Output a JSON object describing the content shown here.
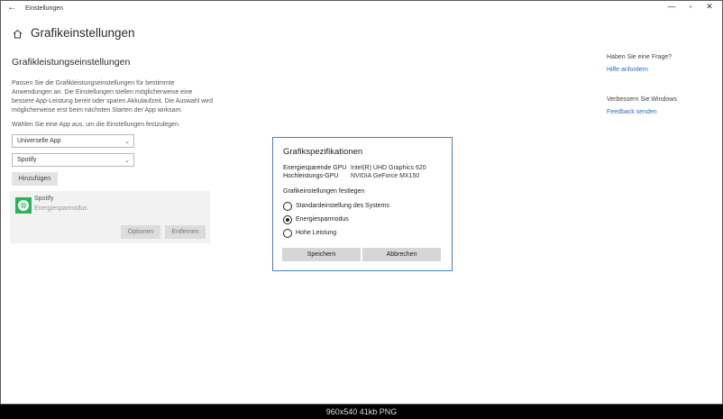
{
  "window": {
    "title": "Einstellungen",
    "back_glyph": "←",
    "minimize_glyph": "—",
    "maximize_glyph": "▫",
    "close_glyph": "✕"
  },
  "page": {
    "title": "Grafikeinstellungen",
    "section_title": "Grafikleistungseinstellungen",
    "description": "Passen Sie die Grafikleistungseinstellungen für bestimmte Anwendungen an. Die Einstellungen stellen möglicherweise eine bessere App-Leistung bereit oder sparen Akkulaufzeit. Die Auswahl wird möglicherweise erst beim nächsten Starten der App wirksam.",
    "choose_label": "Wählen Sie eine App aus, um die Einstellungen festzulegen.",
    "app_type_value": "Universelle App",
    "app_value": "Spotify",
    "add_button": "Hinzufügen"
  },
  "app_card": {
    "name": "Spotify",
    "mode": "Energiesparmodus",
    "options_button": "Optionen",
    "remove_button": "Entfernen"
  },
  "sidebar": {
    "question_heading": "Haben Sie eine Frage?",
    "help_link": "Hilfe anfordern",
    "improve_heading": "Verbessern Sie Windows",
    "feedback_link": "Feedback senden"
  },
  "dialog": {
    "title": "Grafikspezifikationen",
    "specs": [
      {
        "label": "Energiesparende GPU",
        "value": "Intel(R) UHD Graphics 620"
      },
      {
        "label": "Hochleistungs-GPU",
        "value": "NVIDIA GeForce MX150"
      }
    ],
    "preference_label": "Grafikeinstellungen festlegen",
    "options": [
      {
        "label": "Standardeinstellung des Systems",
        "checked": false
      },
      {
        "label": "Energiesparmodus",
        "checked": true
      },
      {
        "label": "Hohe Leistung",
        "checked": false
      }
    ],
    "save_button": "Speichern",
    "cancel_button": "Abbrechen"
  },
  "footer": {
    "image_info": "960x540  41kb  PNG"
  },
  "colors": {
    "accent": "#3c82cc",
    "link": "#2a6fb5",
    "spotify": "#27b658"
  }
}
